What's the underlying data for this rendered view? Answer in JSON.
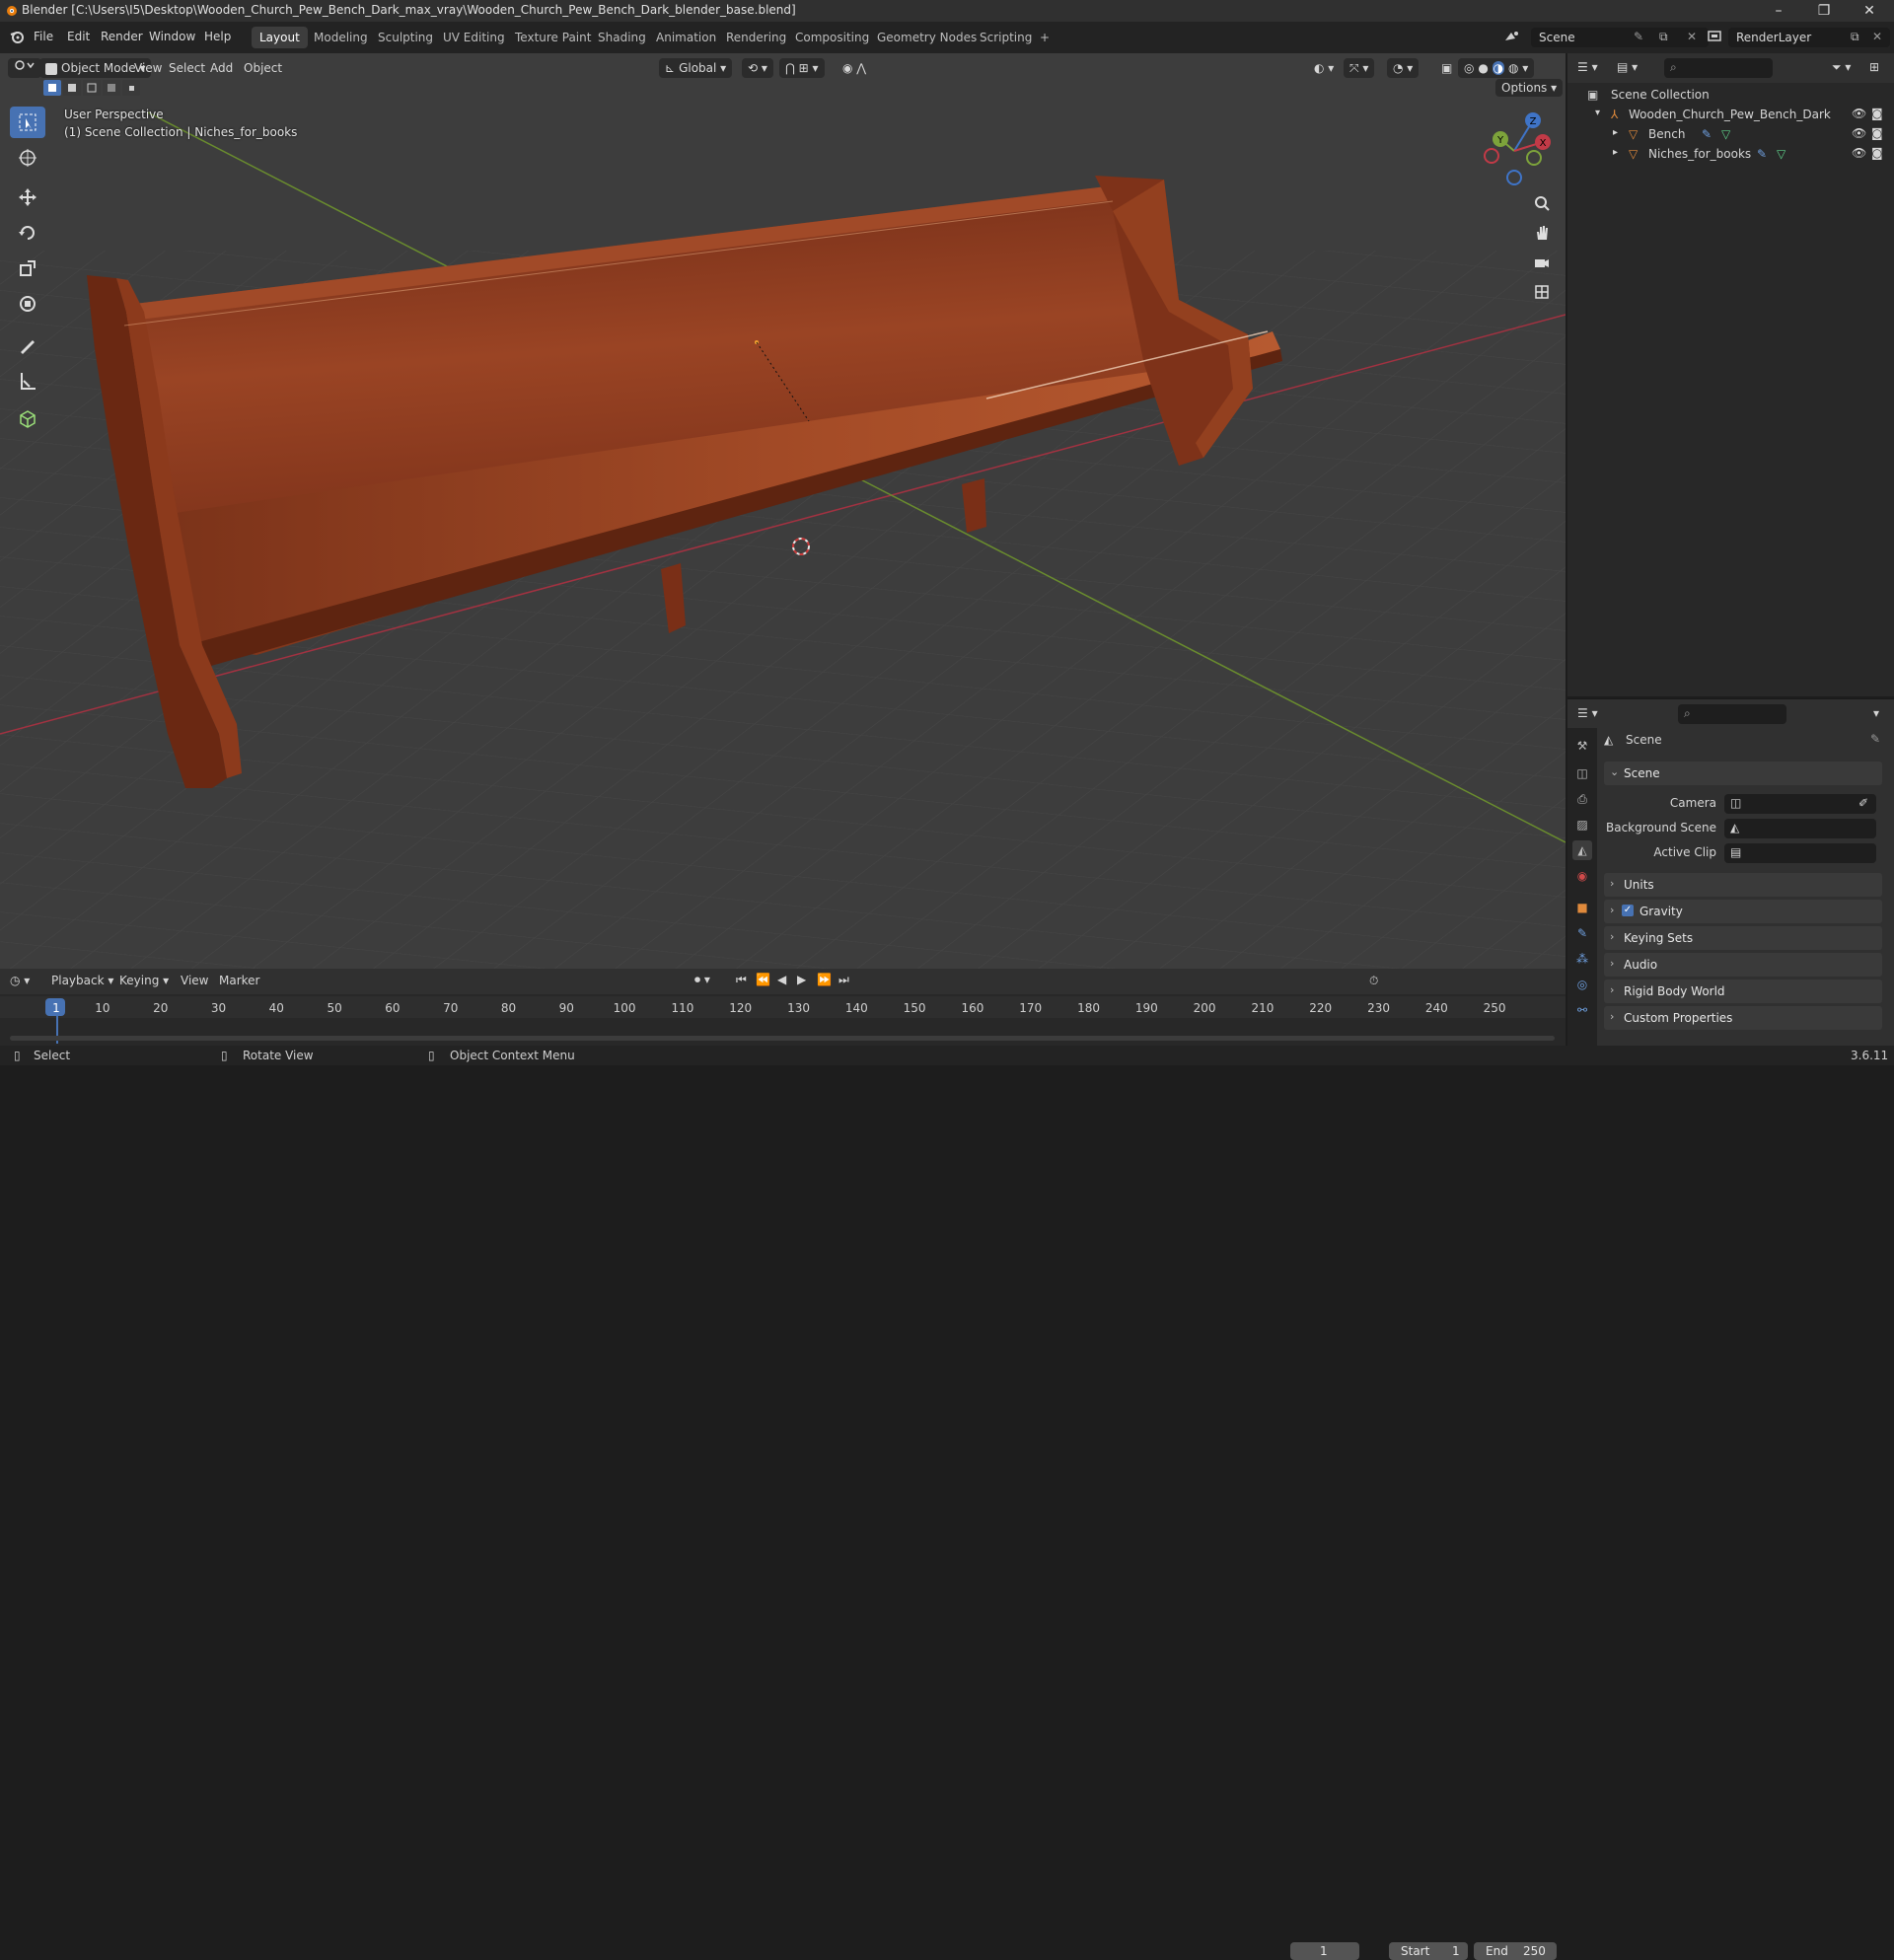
{
  "titlebar": {
    "title": "Blender [C:\\Users\\I5\\Desktop\\Wooden_Church_Pew_Bench_Dark_max_vray\\Wooden_Church_Pew_Bench_Dark_blender_base.blend]",
    "minimize": "–",
    "maximize": "❐",
    "close": "✕"
  },
  "menu": [
    "File",
    "Edit",
    "Render",
    "Window",
    "Help"
  ],
  "workspaces": [
    "Layout",
    "Modeling",
    "Sculpting",
    "UV Editing",
    "Texture Paint",
    "Shading",
    "Animation",
    "Rendering",
    "Compositing",
    "Geometry Nodes",
    "Scripting"
  ],
  "active_workspace": "Layout",
  "add_workspace": "+",
  "scene_name": "Scene",
  "view_layer": "RenderLayer",
  "viewport_header": {
    "mode": "Object Mode",
    "menus": [
      "View",
      "Select",
      "Add",
      "Object"
    ],
    "transform_orientation": "Global",
    "options": "Options"
  },
  "viewport_overlay": {
    "perspective": "User Perspective",
    "collection": "(1) Scene Collection | Niches_for_books"
  },
  "gizmo": {
    "x": "X",
    "y": "Y",
    "z": "Z"
  },
  "outliner": {
    "root": "Scene Collection",
    "items": [
      {
        "name": "Wooden_Church_Pew_Bench_Dark",
        "type": "collection"
      },
      {
        "name": "Bench",
        "type": "mesh"
      },
      {
        "name": "Niches_for_books",
        "type": "mesh"
      }
    ]
  },
  "properties": {
    "context": "Scene",
    "scene_panel": "Scene",
    "fields": [
      {
        "label": "Camera",
        "value": ""
      },
      {
        "label": "Background Scene",
        "value": ""
      },
      {
        "label": "Active Clip",
        "value": ""
      }
    ],
    "panels": [
      "Units",
      "Gravity",
      "Keying Sets",
      "Audio",
      "Rigid Body World",
      "Custom Properties"
    ],
    "gravity_checked": true
  },
  "timeline": {
    "menus": [
      "Playback",
      "Keying",
      "View",
      "Marker"
    ],
    "current_frame": "1",
    "start_label": "Start",
    "start": "1",
    "end_label": "End",
    "end": "250",
    "ticks": [
      "1",
      "10",
      "20",
      "30",
      "40",
      "50",
      "60",
      "70",
      "80",
      "90",
      "100",
      "110",
      "120",
      "130",
      "140",
      "150",
      "160",
      "170",
      "180",
      "190",
      "200",
      "210",
      "220",
      "230",
      "240",
      "250"
    ]
  },
  "statusbar": {
    "select": "Select",
    "rotate": "Rotate View",
    "context_menu": "Object Context Menu",
    "version": "3.6.11"
  },
  "colors": {
    "accent": "#4772b3",
    "viewport_bg": "#3d3d3d",
    "x_axis": "#c23a47",
    "y_axis": "#7da33b",
    "z_axis": "#3f74c7",
    "wood": "#8a3a1e"
  }
}
